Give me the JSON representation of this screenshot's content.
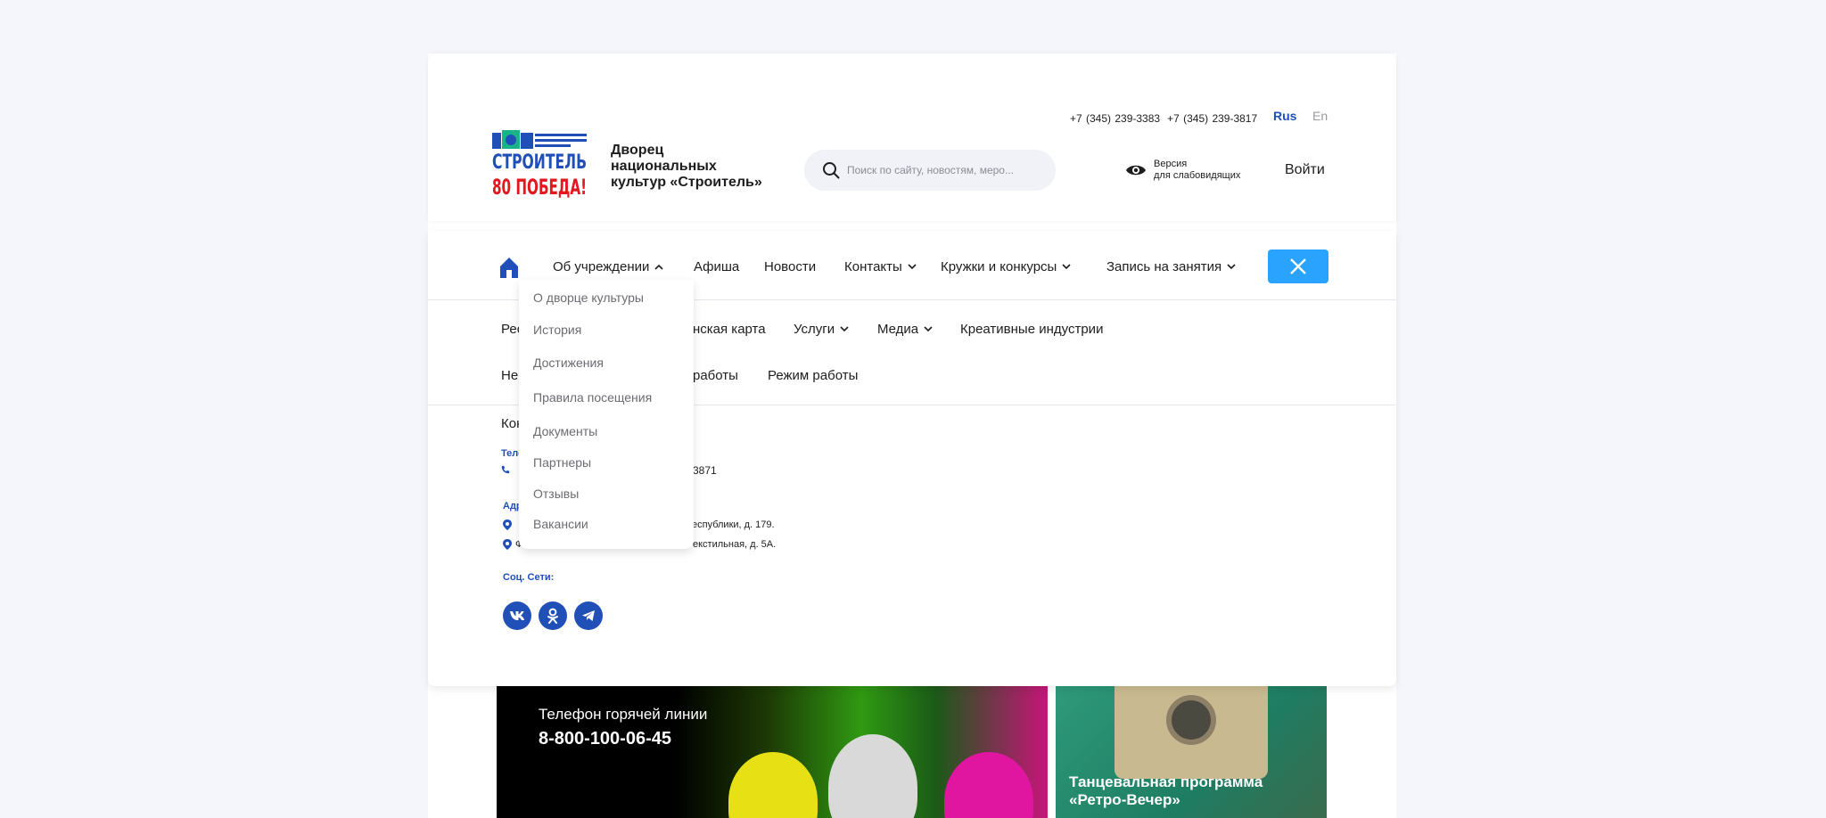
{
  "header": {
    "phones": [
      "+7 (345) 239-3383",
      "+7 (345) 239-3817"
    ],
    "lang_ru": "Rus",
    "lang_en": "En",
    "org_name": "Дворец национальных культур «Строитель»",
    "search_placeholder": "Поиск по сайту, новостям, меро...",
    "accessibility_line1": "Версия",
    "accessibility_line2": "для слабовидящих",
    "login": "Войти"
  },
  "nav": {
    "about": "Об учреждении",
    "afisha": "Афиша",
    "news": "Новости",
    "contacts": "Контакты",
    "clubs": "Кружки и конкурсы",
    "enroll": "Запись на занятия"
  },
  "nav2": {
    "row1_partial1": "Рес",
    "row1_partial2": "нская карта",
    "services": "Услуги",
    "media": "Медиа",
    "creative": "Креативные индустрии",
    "row2_partial1": "Не",
    "row2_partial2": "работы",
    "schedule": "Режим работы"
  },
  "contacts": {
    "title_partial": "Кон",
    "phone_label_partial": "Теле",
    "phone_partial": "3871",
    "address_label_partial": "Адр",
    "address1_partial": "еспублики, д. 179.",
    "address2_prefix": "Ф",
    "address2_partial": "екстильная, д. 5А.",
    "social_label": "Соц. Сети:"
  },
  "dropdown": {
    "items": [
      "О дворце культуры",
      "История",
      "Достижения",
      "Правила посещения",
      "Документы",
      "Партнеры",
      "Отзывы",
      "Вакансии"
    ]
  },
  "banners": {
    "hotline_label": "Телефон горячей линии",
    "hotline_number": "8-800-100-06-45",
    "event_title": "Танцевальная программа «Ретро-Вечер»"
  },
  "colors": {
    "brand_blue": "#1f4fb7",
    "accent_light_blue": "#2aa3ff",
    "background": "#f5f6fb"
  }
}
